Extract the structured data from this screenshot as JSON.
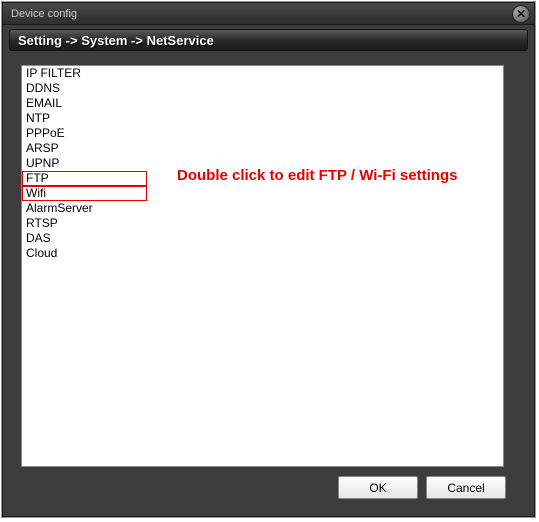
{
  "window": {
    "title": "Device config"
  },
  "breadcrumb": "Setting -> System -> NetService",
  "list": {
    "items": [
      "IP FILTER",
      "DDNS",
      "EMAIL",
      "NTP",
      "PPPoE",
      "ARSP",
      "UPNP",
      "FTP",
      "Wifi",
      "AlarmServer",
      "RTSP",
      "DAS",
      "Cloud"
    ]
  },
  "annotation": {
    "text": "Double click to edit FTP / Wi-Fi settings"
  },
  "buttons": {
    "ok": "OK",
    "cancel": "Cancel"
  }
}
